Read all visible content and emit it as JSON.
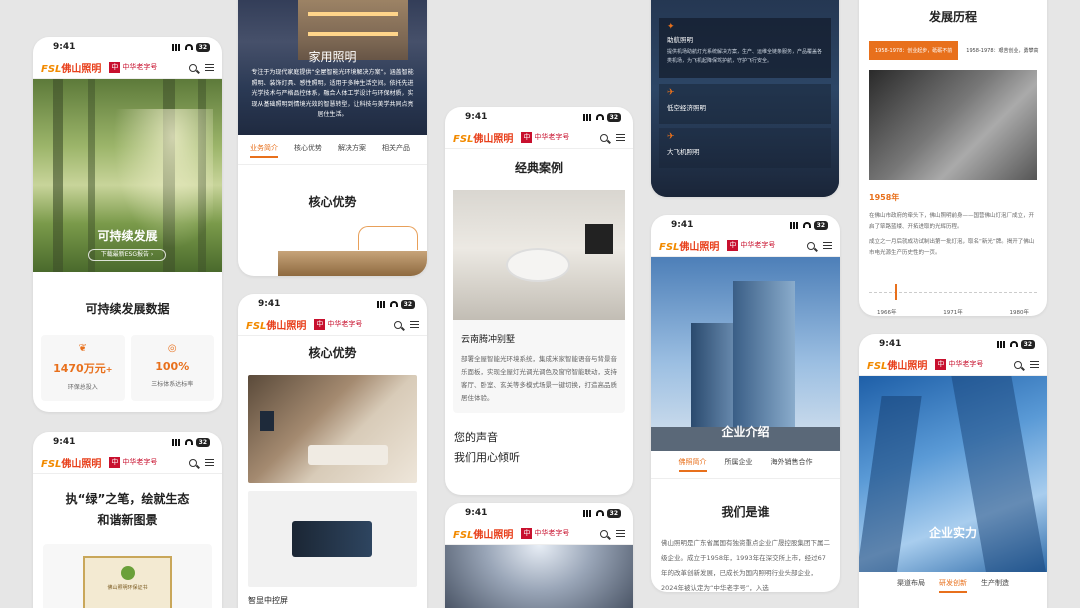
{
  "status": {
    "time": "9:41",
    "battery": "32"
  },
  "brand": {
    "fsl": "FSL",
    "name": "佛山照明",
    "ct_mark": "中",
    "ct_cn": "中华老字号",
    "ct_en": "China Time-honored Brand"
  },
  "p1": {
    "hero_title": "可持续发展",
    "hero_btn": "下载最新ESG报告 ›",
    "section": "可持续发展数据",
    "stat1_value": "1470万元",
    "stat1_plus": "+",
    "stat1_label": "环保总投入",
    "stat2_value": "100%",
    "stat2_label": "三标体系达标率"
  },
  "p2": {
    "title1": "执“绿”之笔，绘就生态",
    "title2": "和谐新图景",
    "cert": "佛山照明环保证书"
  },
  "p3": {
    "hero_title": "家用照明",
    "hero_text": "专注于为现代家庭提供“全屋智能光环境解决方案”。涵盖智能照明、装饰灯具、感性照明，适用于多种生活空间。依托先进光学技术与严格品控体系，融合人体工学设计与环保材质，实现从基础照明到情境光效的智慧转型，让科技与美学共同点亮居住生活。",
    "tabs": [
      "业务简介",
      "核心优势",
      "解决方案",
      "相关产品"
    ],
    "section": "核心优势"
  },
  "p4": {
    "section": "核心优势",
    "caption": "智显中控屏"
  },
  "p5": {
    "section": "经典案例",
    "case_title": "云南腾冲别墅",
    "case_text": "部署全屋智能光环境系统，集成米家智能语音与背景音乐面板，实现全屋灯光调光调色及窗帘智能联动，支持客厅、卧室、玄关等多模式场景一键切换，打造高品质居住体验。",
    "voice1": "您的声音",
    "voice2": "我们用心倾听"
  },
  "p7": {
    "item1": "助航照明",
    "item1_text": "提供机场助航灯光系统解决方案，生产、运维全链条服务，产品覆盖各类机场，为飞机起降保驾护航，守护飞行安全。",
    "item2": "低空经济照明",
    "item3": "大飞机照明"
  },
  "p8": {
    "hero_title": "企业介绍",
    "tabs": [
      "佛照简介",
      "所属企业",
      "海外销售合作"
    ],
    "section": "我们是谁",
    "text": "佛山照明是广东省属国有独资重点企业广晟控股集团下属二级企业。成立于1958年，1993年在深交所上市，经过67年的改革创新发展，已成长为国内照明行业头部企业，2024年被认定为“中华老字号”，入选"
  },
  "p9": {
    "title": "发展历程",
    "tl1": "1958-1978：创业起步，砥砺不前",
    "tl2": "1958-1978：艰苦创业，勇攀高",
    "year": "1958年",
    "text1": "在佛山市政府的牵头下，佛山照明前身——国营佛山灯泡厂成立，开启了筚路蓝缕、开拓进取的光辉历程。",
    "text2": "成立之一月后就成功试制出第一批灯泡，取名“新光”牌。揭开了佛山市电光源生产历史性的一页。",
    "axis": [
      "1966年",
      "1971年",
      "1980年"
    ]
  },
  "p10": {
    "hero_title": "企业实力",
    "tabs": [
      "渠道布局",
      "研发创新",
      "生产制造"
    ]
  }
}
